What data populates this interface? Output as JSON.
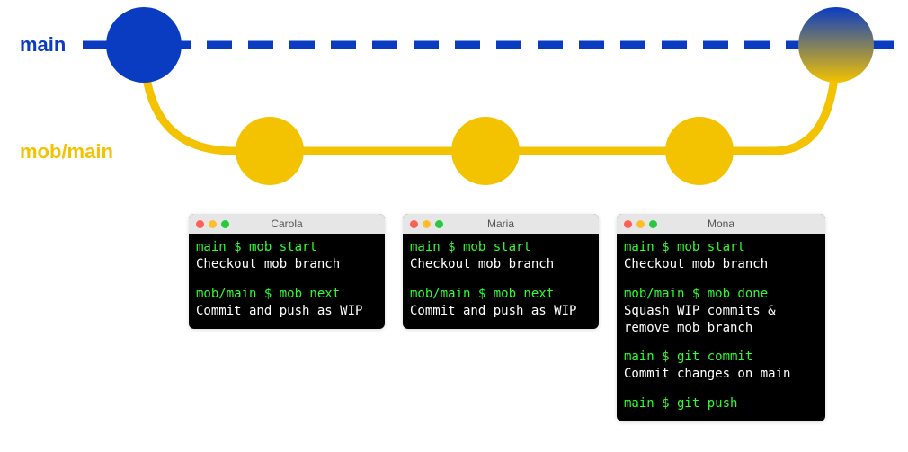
{
  "branches": {
    "main_label": "main",
    "mob_label": "mob/main"
  },
  "colors": {
    "blue": "#0a3cc2",
    "yellow": "#f3c200",
    "green_text": "#2bff2b"
  },
  "terminals": [
    {
      "title": "Carola",
      "lines": [
        {
          "type": "cmd",
          "text": "main $ mob start"
        },
        {
          "type": "out",
          "text": "Checkout mob branch"
        },
        {
          "type": "blank"
        },
        {
          "type": "cmd",
          "text": "mob/main $ mob next"
        },
        {
          "type": "out",
          "text": "Commit and push as WIP"
        }
      ]
    },
    {
      "title": "Maria",
      "lines": [
        {
          "type": "cmd",
          "text": "main $ mob start"
        },
        {
          "type": "out",
          "text": "Checkout mob branch"
        },
        {
          "type": "blank"
        },
        {
          "type": "cmd",
          "text": "mob/main $ mob next"
        },
        {
          "type": "out",
          "text": "Commit and push as WIP"
        }
      ]
    },
    {
      "title": "Mona",
      "lines": [
        {
          "type": "cmd",
          "text": "main $ mob start"
        },
        {
          "type": "out",
          "text": "Checkout mob branch"
        },
        {
          "type": "blank"
        },
        {
          "type": "cmd",
          "text": "mob/main $ mob done"
        },
        {
          "type": "out",
          "text": "Squash WIP commits & remove mob branch"
        },
        {
          "type": "blank"
        },
        {
          "type": "cmd",
          "text": "main $ git commit"
        },
        {
          "type": "out",
          "text": "Commit changes on main"
        },
        {
          "type": "blank"
        },
        {
          "type": "cmd",
          "text": "main $ git push"
        }
      ]
    }
  ]
}
